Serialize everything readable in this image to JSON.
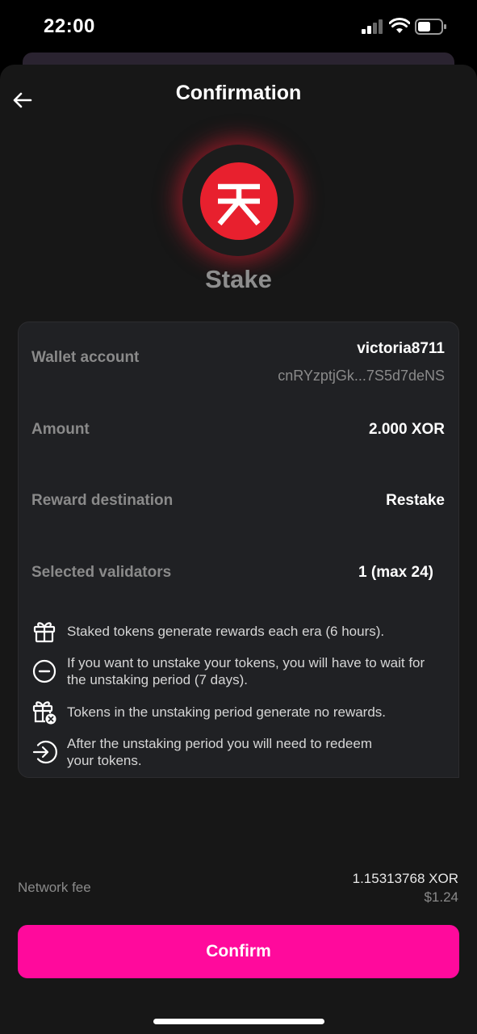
{
  "status_bar": {
    "time": "22:00"
  },
  "header": {
    "title": "Confirmation",
    "back_icon": "arrow-left-icon"
  },
  "operation": {
    "title": "Stake",
    "logo_icon": "sora-logo-icon",
    "accent": "#e8202e"
  },
  "details": {
    "wallet_label": "Wallet account",
    "wallet_name": "victoria8711",
    "wallet_address": "cnRYzptjGk...7S5d7deNS",
    "amount_label": "Amount",
    "amount_value": "2.000 XOR",
    "reward_label": "Reward destination",
    "reward_value": "Restake",
    "validators_label": "Selected validators",
    "validators_value": "1 (max 24)"
  },
  "hints": [
    {
      "icon": "gift-icon",
      "line1": "Staked tokens generate rewards each era (6 hours).",
      "line2": ""
    },
    {
      "icon": "minus-circle-icon",
      "line1": "If you want to unstake your tokens, you will have to wait for",
      "line2": "the unstaking period (7 days)."
    },
    {
      "icon": "gift-cancel-icon",
      "line1": "Tokens in the unstaking period generate no rewards.",
      "line2": ""
    },
    {
      "icon": "arrow-in-circle-icon",
      "line1": "After the unstaking period you will need to redeem",
      "line2": "your tokens."
    }
  ],
  "fee": {
    "label": "Network fee",
    "amount": "1.15313768 XOR",
    "fiat": "$1.24"
  },
  "confirm_button": {
    "label": "Confirm",
    "color": "#ff0a9c"
  }
}
